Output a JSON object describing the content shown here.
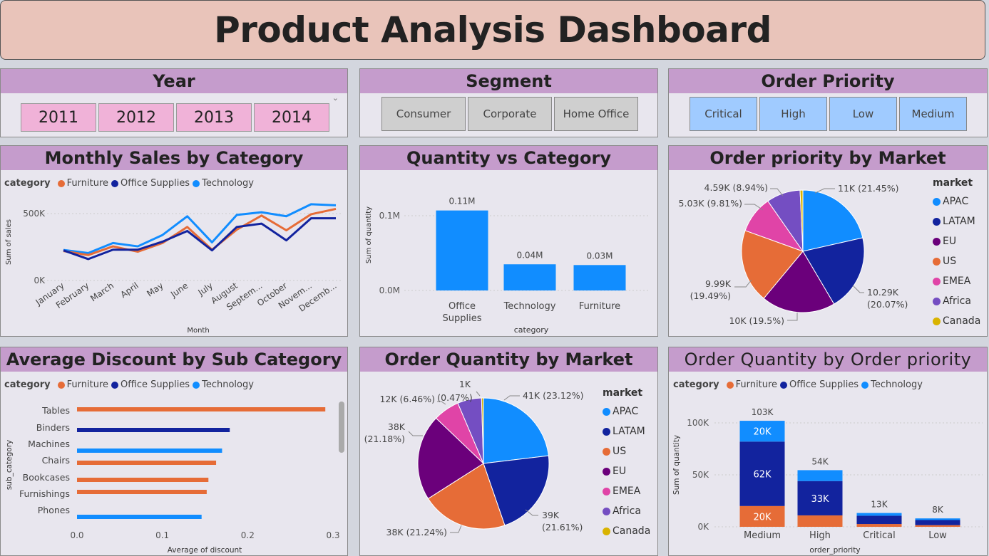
{
  "title": "Product Analysis Dashboard",
  "colors": {
    "Furniture": "#e66c37",
    "Office Supplies": "#12239e",
    "Technology": "#118dff",
    "APAC": "#118dff",
    "LATAM": "#12239e",
    "EU": "#6b007b",
    "US": "#e66c37",
    "EMEA": "#e044a7",
    "Africa": "#744ec2",
    "Canada": "#d9b300"
  },
  "slicers": {
    "year": {
      "title": "Year",
      "options": [
        "2011",
        "2012",
        "2013",
        "2014"
      ]
    },
    "segment": {
      "title": "Segment",
      "options": [
        "Consumer",
        "Corporate",
        "Home Office"
      ]
    },
    "priority": {
      "title": "Order Priority",
      "options": [
        "Critical",
        "High",
        "Low",
        "Medium"
      ]
    }
  },
  "legend_category": {
    "title": "category",
    "items": [
      "Furniture",
      "Office Supplies",
      "Technology"
    ]
  },
  "legend_market": {
    "title": "market"
  },
  "chart_data": [
    {
      "id": "monthly",
      "type": "line",
      "title": "Monthly Sales by Category",
      "xlabel": "Month",
      "ylabel": "Sum of sales",
      "categories": [
        "January",
        "February",
        "March",
        "April",
        "May",
        "June",
        "July",
        "August",
        "Septem...",
        "October",
        "Novem...",
        "Decemb..."
      ],
      "yticks": [
        "0K",
        "500K"
      ],
      "ylim": [
        0,
        500000
      ],
      "series": [
        {
          "name": "Furniture",
          "values": [
            220000,
            190000,
            255000,
            215000,
            280000,
            400000,
            230000,
            380000,
            485000,
            375000,
            495000,
            535000
          ]
        },
        {
          "name": "Office Supplies",
          "values": [
            225000,
            160000,
            230000,
            230000,
            290000,
            370000,
            225000,
            400000,
            425000,
            300000,
            465000,
            465000
          ]
        },
        {
          "name": "Technology",
          "values": [
            228000,
            205000,
            280000,
            255000,
            340000,
            480000,
            285000,
            490000,
            510000,
            480000,
            570000,
            562000
          ]
        }
      ]
    },
    {
      "id": "qty_cat",
      "type": "bar",
      "title": "Quantity vs Category",
      "xlabel": "category",
      "ylabel": "Sum of quantity",
      "categories": [
        "Office Supplies",
        "Technology",
        "Furniture"
      ],
      "values": [
        0.107,
        0.035,
        0.034
      ],
      "data_labels": [
        "0.11M",
        "0.04M",
        "0.03M"
      ],
      "yticks": [
        "0.0M",
        "0.1M"
      ],
      "ylim": [
        0,
        0.1
      ]
    },
    {
      "id": "prio_market",
      "type": "pie",
      "title": "Order priority by Market",
      "legend": [
        "APAC",
        "LATAM",
        "EU",
        "US",
        "EMEA",
        "Africa",
        "Canada"
      ],
      "slices": [
        {
          "label": "APAC",
          "value": 21.45,
          "text": "11K (21.45%)"
        },
        {
          "label": "LATAM",
          "value": 20.07,
          "text": "10.29K (20.07%)"
        },
        {
          "label": "EU",
          "value": 19.5,
          "text": "10K (19.5%)"
        },
        {
          "label": "US",
          "value": 19.49,
          "text": "9.99K (19.49%)"
        },
        {
          "label": "EMEA",
          "value": 9.81,
          "text": "5.03K (9.81%)"
        },
        {
          "label": "Africa",
          "value": 8.94,
          "text": "4.59K (8.94%)"
        },
        {
          "label": "Canada",
          "value": 0.74,
          "text": ""
        }
      ]
    },
    {
      "id": "discount",
      "type": "bar",
      "orientation": "horizontal",
      "title": "Average Discount by Sub Category",
      "xlabel": "Average of discount",
      "ylabel": "sub_category",
      "xticks": [
        "0.0",
        "0.1",
        "0.2",
        "0.3"
      ],
      "xlim": [
        0,
        0.3
      ],
      "bars": [
        {
          "category": "Tables",
          "series": "Furniture",
          "value": 0.291
        },
        {
          "category": "Binders",
          "series": "Office Supplies",
          "value": 0.179
        },
        {
          "category": "Machines",
          "series": "Technology",
          "value": 0.17
        },
        {
          "category": "Chairs",
          "series": "Furniture",
          "value": 0.163
        },
        {
          "category": "Bookcases",
          "series": "Furniture",
          "value": 0.154
        },
        {
          "category": "Furnishings",
          "series": "Furniture",
          "value": 0.152
        },
        {
          "category": "Phones",
          "series": "Technology",
          "value": 0.146
        }
      ]
    },
    {
      "id": "qty_market",
      "type": "pie",
      "title": "Order Quantity by Market",
      "legend": [
        "APAC",
        "LATAM",
        "US",
        "EU",
        "EMEA",
        "Africa",
        "Canada"
      ],
      "slices": [
        {
          "label": "APAC",
          "value": 23.12,
          "text": "41K (23.12%)"
        },
        {
          "label": "LATAM",
          "value": 21.61,
          "text": "39K (21.61%)"
        },
        {
          "label": "US",
          "value": 21.24,
          "text": "38K (21.24%)"
        },
        {
          "label": "EU",
          "value": 21.18,
          "text": "38K (21.18%)"
        },
        {
          "label": "EMEA",
          "value": 6.46,
          "text": "12K (6.46%)"
        },
        {
          "label": "Africa",
          "value": 5.92,
          "text": ""
        },
        {
          "label": "Canada",
          "value": 0.47,
          "text": "1K (0.47%)"
        }
      ]
    },
    {
      "id": "qty_prio",
      "type": "bar",
      "stacked": true,
      "title": "Order Quantity by Order priority",
      "xlabel": "order_priority",
      "ylabel": "Sum of quantity",
      "categories": [
        "Medium",
        "High",
        "Critical",
        "Low"
      ],
      "totals": [
        "103K",
        "54K",
        "13K",
        "8K"
      ],
      "yticks": [
        "0K",
        "50K",
        "100K"
      ],
      "ylim": [
        0,
        100
      ],
      "series": [
        {
          "name": "Furniture",
          "values": [
            20,
            11,
            2.7,
            1.6
          ],
          "labels": [
            "20K",
            "",
            "",
            ""
          ]
        },
        {
          "name": "Office Supplies",
          "values": [
            62,
            33,
            8,
            4.9
          ],
          "labels": [
            "62K",
            "33K",
            "",
            ""
          ]
        },
        {
          "name": "Technology",
          "values": [
            20,
            10.5,
            2.6,
            1.6
          ],
          "labels": [
            "20K",
            "",
            "",
            ""
          ]
        }
      ]
    }
  ]
}
